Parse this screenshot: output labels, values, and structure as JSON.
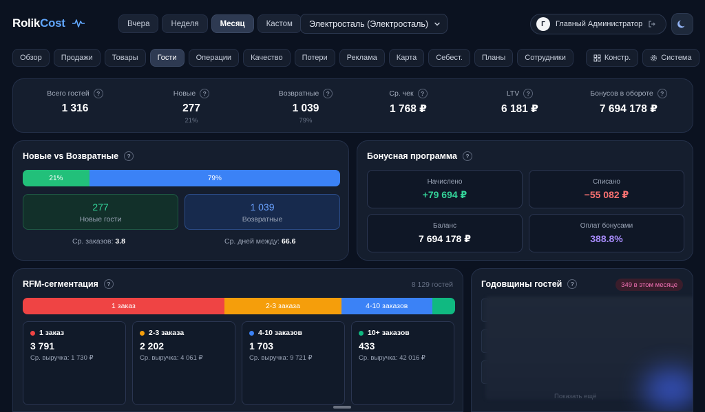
{
  "app": {
    "logo_main": "Rolik",
    "logo_accent": "Cost",
    "icon": "pulse-icon"
  },
  "periods": [
    {
      "label": "Вчера",
      "active": false
    },
    {
      "label": "Неделя",
      "active": false
    },
    {
      "label": "Месяц",
      "active": true
    },
    {
      "label": "Кастом",
      "active": false
    }
  ],
  "city_select": {
    "value": "Электросталь (Электросталь)"
  },
  "user": {
    "initial": "Г",
    "name": "Главный Администратор"
  },
  "nav": {
    "tabs": [
      {
        "label": "Обзор",
        "active": false
      },
      {
        "label": "Продажи",
        "active": false
      },
      {
        "label": "Товары",
        "active": false
      },
      {
        "label": "Гости",
        "active": true
      },
      {
        "label": "Операции",
        "active": false
      },
      {
        "label": "Качество",
        "active": false
      },
      {
        "label": "Потери",
        "active": false
      },
      {
        "label": "Реклама",
        "active": false
      },
      {
        "label": "Карта",
        "active": false
      },
      {
        "label": "Себест.",
        "active": false
      },
      {
        "label": "Планы",
        "active": false
      },
      {
        "label": "Сотрудники",
        "active": false
      }
    ],
    "constructor_label": "Констр.",
    "system_label": "Система"
  },
  "kpis": [
    {
      "label": "Всего гостей",
      "value": "1 316",
      "sub": ""
    },
    {
      "label": "Новые",
      "value": "277",
      "sub": "21%"
    },
    {
      "label": "Возвратные",
      "value": "1 039",
      "sub": "79%"
    },
    {
      "label": "Ср. чек",
      "value": "1 768 ₽",
      "sub": ""
    },
    {
      "label": "LTV",
      "value": "6 181 ₽",
      "sub": ""
    },
    {
      "label": "Бонусов в обороте",
      "value": "7 694 178 ₽",
      "sub": ""
    }
  ],
  "new_vs_returning": {
    "title": "Новые vs Возвратные",
    "new_pct": 21,
    "returning_pct": 79,
    "new_pct_label": "21%",
    "returning_pct_label": "79%",
    "new_count": "277",
    "new_label": "Новые гости",
    "returning_count": "1 039",
    "returning_label": "Возвратные",
    "avg_orders_label": "Ср. заказов:",
    "avg_orders_value": "3.8",
    "avg_days_label": "Ср. дней между:",
    "avg_days_value": "66.6",
    "colors": {
      "new": "#22c07a",
      "returning": "#3b82f6"
    }
  },
  "bonus": {
    "title": "Бонусная программа",
    "accrued_label": "Начислено",
    "accrued_value": "+79 694 ₽",
    "spent_label": "Списано",
    "spent_value": "−55 082 ₽",
    "balance_label": "Баланс",
    "balance_value": "7 694 178 ₽",
    "paid_label": "Оплат бонусами",
    "paid_value": "388.8%",
    "colors": {
      "accrued": "#34d399",
      "spent": "#f87171",
      "paid": "#a78bfa"
    }
  },
  "rfm": {
    "title": "RFM-сегментация",
    "total": "8 129 гостей",
    "segments": [
      {
        "name": "1 заказ",
        "count": "3 791",
        "count_num": 3791,
        "revenue": "Ср. выручка: 1 730 ₽",
        "color": "#ef4444"
      },
      {
        "name": "2-3 заказа",
        "count": "2 202",
        "count_num": 2202,
        "revenue": "Ср. выручка: 4 061 ₽",
        "color": "#f59e0b"
      },
      {
        "name": "4-10 заказов",
        "count": "1 703",
        "count_num": 1703,
        "revenue": "Ср. выручка: 9 721 ₽",
        "color": "#3b82f6"
      },
      {
        "name": "10+ заказов",
        "count": "433",
        "count_num": 433,
        "revenue": "Ср. выручка: 42 016 ₽",
        "color": "#10b981"
      }
    ]
  },
  "anniversaries": {
    "title": "Годовщины гостей",
    "badge": "349 в этом месяце",
    "show_more": "Показать ещё"
  }
}
